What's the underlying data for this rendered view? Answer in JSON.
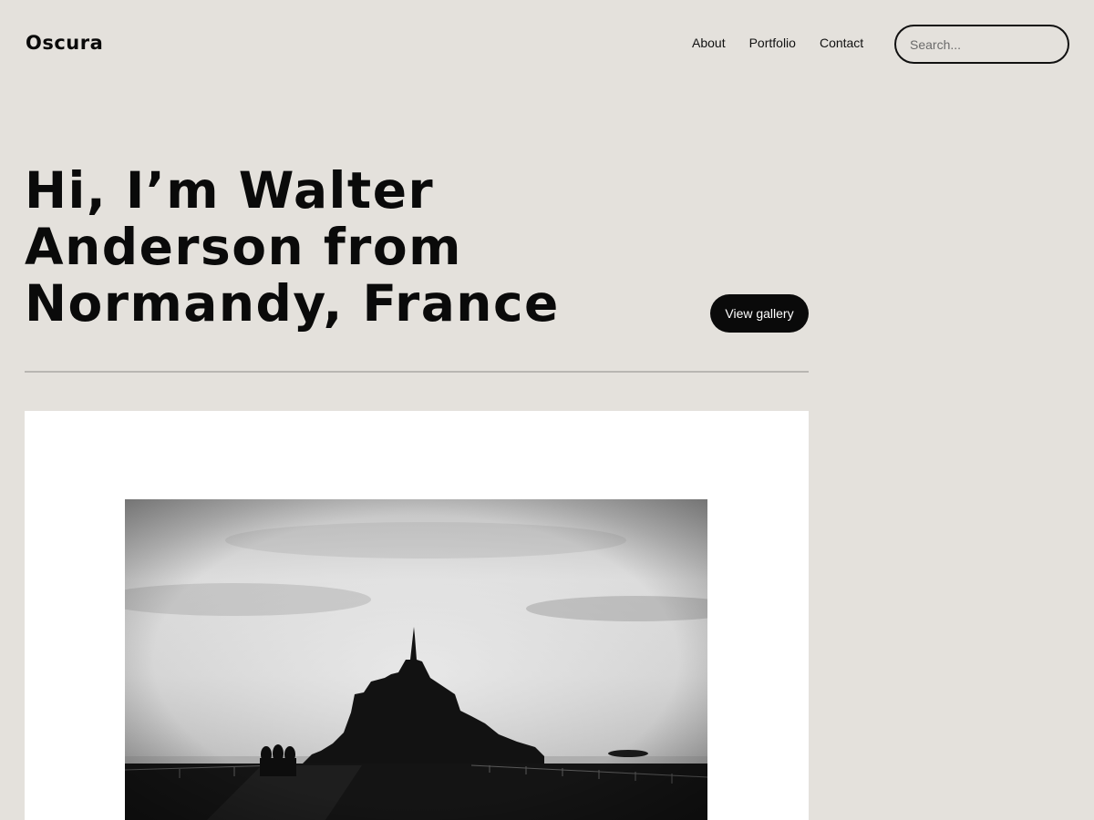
{
  "header": {
    "site_title": "Oscura",
    "nav": [
      {
        "label": "About"
      },
      {
        "label": "Portfolio"
      },
      {
        "label": "Contact"
      }
    ],
    "search": {
      "placeholder": "Search..."
    }
  },
  "hero": {
    "heading_lines": [
      "Hi, I’m Walter",
      "Anderson from",
      "Normandy, France"
    ],
    "cta_label": "View gallery"
  },
  "featured_image": {
    "icon": "mont-saint-michel-photo"
  },
  "colors": {
    "background": "#e4e1dc",
    "text": "#0a0a0a",
    "button_bg": "#0a0a0a",
    "panel_bg": "#ffffff",
    "divider": "#b8b6b2"
  }
}
